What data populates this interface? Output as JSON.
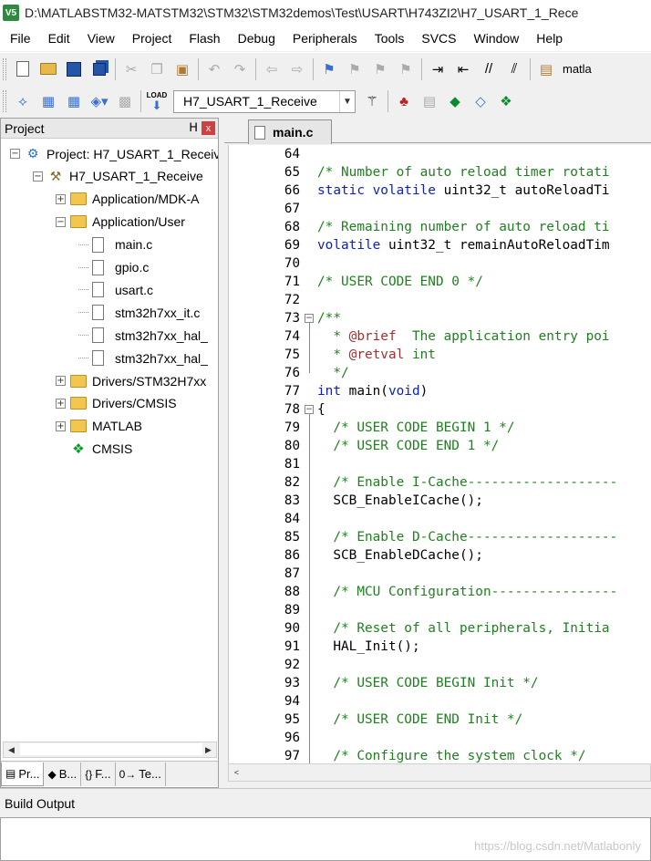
{
  "window": {
    "title": "D:\\MATLABSTM32-MATSTM32\\STM32\\STM32demos\\Test\\USART\\H743ZI2\\H7_USART_1_Rece",
    "app_icon": "V5"
  },
  "menu": [
    "File",
    "Edit",
    "View",
    "Project",
    "Flash",
    "Debug",
    "Peripherals",
    "Tools",
    "SVCS",
    "Window",
    "Help"
  ],
  "toolbar1": {
    "label": "matla"
  },
  "toolbar2": {
    "target": "H7_USART_1_Receive",
    "load_label": "LOAD"
  },
  "project_panel": {
    "title": "Project",
    "pin": "ɰ",
    "close": "x",
    "tree": [
      {
        "label": "Project: H7_USART_1_Receiv",
        "level": 0,
        "toggle": "−",
        "icon": "project"
      },
      {
        "label": "H7_USART_1_Receive",
        "level": 1,
        "toggle": "−",
        "icon": "target"
      },
      {
        "label": "Application/MDK-A",
        "level": 2,
        "toggle": "+",
        "icon": "folder"
      },
      {
        "label": "Application/User",
        "level": 2,
        "toggle": "−",
        "icon": "folder"
      },
      {
        "label": "main.c",
        "level": 3,
        "toggle": "",
        "icon": "file"
      },
      {
        "label": "gpio.c",
        "level": 3,
        "toggle": "",
        "icon": "file"
      },
      {
        "label": "usart.c",
        "level": 3,
        "toggle": "",
        "icon": "file"
      },
      {
        "label": "stm32h7xx_it.c",
        "level": 3,
        "toggle": "",
        "icon": "file"
      },
      {
        "label": "stm32h7xx_hal_",
        "level": 3,
        "toggle": "",
        "icon": "file"
      },
      {
        "label": "stm32h7xx_hal_",
        "level": 3,
        "toggle": "",
        "icon": "file"
      },
      {
        "label": "Drivers/STM32H7xx",
        "level": 2,
        "toggle": "+",
        "icon": "folder"
      },
      {
        "label": "Drivers/CMSIS",
        "level": 2,
        "toggle": "+",
        "icon": "folder"
      },
      {
        "label": "MATLAB",
        "level": 2,
        "toggle": "+",
        "icon": "folder"
      },
      {
        "label": "CMSIS",
        "level": 2,
        "toggle": "",
        "icon": "cmsis"
      }
    ],
    "tabs": [
      {
        "label": "Pr...",
        "icon": "project-icon"
      },
      {
        "label": "B...",
        "icon": "books-icon"
      },
      {
        "label": "F...",
        "icon": "functions-icon"
      },
      {
        "label": "Te...",
        "icon": "templates-icon"
      }
    ],
    "tab_glyphs": [
      "▤",
      "◆",
      "{}",
      "0→"
    ]
  },
  "editor": {
    "active_tab": "main.c",
    "lines": [
      {
        "n": "64",
        "fold": "",
        "parts": []
      },
      {
        "n": "65",
        "fold": "",
        "parts": [
          {
            "t": "/* Number of auto reload timer rotati",
            "c": "cm"
          }
        ]
      },
      {
        "n": "66",
        "fold": "",
        "parts": [
          {
            "t": "static volatile ",
            "c": "kw"
          },
          {
            "t": "uint32_t autoReloadTi",
            "c": "tx"
          }
        ]
      },
      {
        "n": "67",
        "fold": "",
        "parts": []
      },
      {
        "n": "68",
        "fold": "",
        "parts": [
          {
            "t": "/* Remaining number of auto reload ti",
            "c": "cm"
          }
        ]
      },
      {
        "n": "69",
        "fold": "",
        "parts": [
          {
            "t": "volatile ",
            "c": "kw"
          },
          {
            "t": "uint32_t remainAutoReloadTim",
            "c": "tx"
          }
        ]
      },
      {
        "n": "70",
        "fold": "",
        "parts": []
      },
      {
        "n": "71",
        "fold": "",
        "parts": [
          {
            "t": "/* USER CODE END 0 */",
            "c": "cm"
          }
        ]
      },
      {
        "n": "72",
        "fold": "",
        "parts": []
      },
      {
        "n": "73",
        "fold": "−",
        "parts": [
          {
            "t": "/**",
            "c": "cm"
          }
        ]
      },
      {
        "n": "74",
        "fold": "",
        "parts": [
          {
            "t": "  * ",
            "c": "cm"
          },
          {
            "t": "@brief",
            "c": "tag"
          },
          {
            "t": "  The application entry poi",
            "c": "cm"
          }
        ]
      },
      {
        "n": "75",
        "fold": "",
        "parts": [
          {
            "t": "  * ",
            "c": "cm"
          },
          {
            "t": "@retval",
            "c": "tag"
          },
          {
            "t": " int",
            "c": "cm"
          }
        ]
      },
      {
        "n": "76",
        "fold": "",
        "parts": [
          {
            "t": "  */",
            "c": "cm"
          }
        ]
      },
      {
        "n": "77",
        "fold": "",
        "parts": [
          {
            "t": "int ",
            "c": "kw"
          },
          {
            "t": "main(",
            "c": "tx"
          },
          {
            "t": "void",
            "c": "kw"
          },
          {
            "t": ")",
            "c": "tx"
          }
        ]
      },
      {
        "n": "78",
        "fold": "−",
        "parts": [
          {
            "t": "{",
            "c": "tx"
          }
        ]
      },
      {
        "n": "79",
        "fold": "",
        "parts": [
          {
            "t": "  /* USER CODE BEGIN 1 */",
            "c": "cm"
          }
        ]
      },
      {
        "n": "80",
        "fold": "",
        "parts": [
          {
            "t": "  /* USER CODE END 1 */",
            "c": "cm"
          }
        ]
      },
      {
        "n": "81",
        "fold": "",
        "parts": []
      },
      {
        "n": "82",
        "fold": "",
        "parts": [
          {
            "t": "  /* Enable I-Cache-------------------",
            "c": "cm"
          }
        ]
      },
      {
        "n": "83",
        "fold": "",
        "parts": [
          {
            "t": "  SCB_EnableICache();",
            "c": "tx"
          }
        ]
      },
      {
        "n": "84",
        "fold": "",
        "parts": []
      },
      {
        "n": "85",
        "fold": "",
        "parts": [
          {
            "t": "  /* Enable D-Cache-------------------",
            "c": "cm"
          }
        ]
      },
      {
        "n": "86",
        "fold": "",
        "parts": [
          {
            "t": "  SCB_EnableDCache();",
            "c": "tx"
          }
        ]
      },
      {
        "n": "87",
        "fold": "",
        "parts": []
      },
      {
        "n": "88",
        "fold": "",
        "parts": [
          {
            "t": "  /* MCU Configuration----------------",
            "c": "cm"
          }
        ]
      },
      {
        "n": "89",
        "fold": "",
        "parts": []
      },
      {
        "n": "90",
        "fold": "",
        "parts": [
          {
            "t": "  /* Reset of all peripherals, Initia",
            "c": "cm"
          }
        ]
      },
      {
        "n": "91",
        "fold": "",
        "parts": [
          {
            "t": "  HAL_Init();",
            "c": "tx"
          }
        ]
      },
      {
        "n": "92",
        "fold": "",
        "parts": []
      },
      {
        "n": "93",
        "fold": "",
        "parts": [
          {
            "t": "  /* USER CODE BEGIN Init */",
            "c": "cm"
          }
        ]
      },
      {
        "n": "94",
        "fold": "",
        "parts": []
      },
      {
        "n": "95",
        "fold": "",
        "parts": [
          {
            "t": "  /* USER CODE END Init */",
            "c": "cm"
          }
        ]
      },
      {
        "n": "96",
        "fold": "",
        "parts": []
      },
      {
        "n": "97",
        "fold": "",
        "parts": [
          {
            "t": "  /* Configure the system clock */",
            "c": "cm"
          }
        ]
      }
    ],
    "scroll_left": "<"
  },
  "build_output": {
    "title": "Build Output",
    "watermark": "https://blog.csdn.net/Matlabonly"
  }
}
